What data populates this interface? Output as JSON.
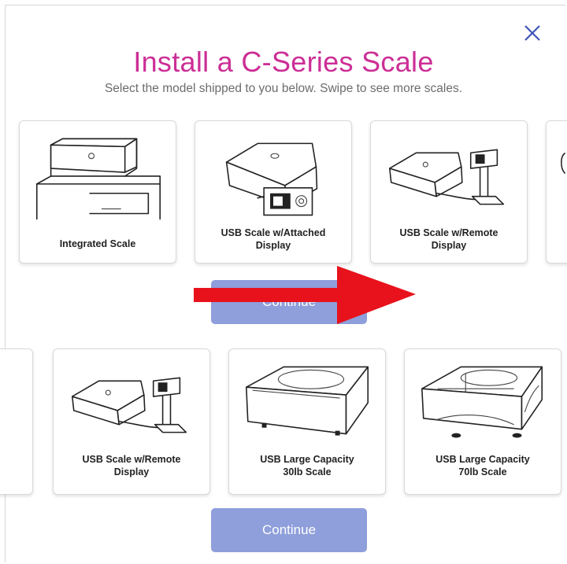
{
  "dialog": {
    "title": "Install a C-Series Scale",
    "subtitle": "Select the model shipped to you below. Swipe to see more scales.",
    "close_icon": "close-icon"
  },
  "top_row": {
    "cards": [
      {
        "label_line1": "Integrated Scale",
        "label_line2": ""
      },
      {
        "label_line1": "USB Scale w/Attached",
        "label_line2": "Display"
      },
      {
        "label_line1": "USB Scale w/Remote",
        "label_line2": "Display"
      }
    ],
    "continue_label": "Continue"
  },
  "bottom_row": {
    "cards": [
      {
        "label_line1": "USB Scale w/Remote",
        "label_line2": "Display"
      },
      {
        "label_line1": "USB Large Capacity",
        "label_line2": "30lb Scale"
      },
      {
        "label_line1": "USB Large Capacity",
        "label_line2": "70lb Scale"
      }
    ],
    "continue_label": "Continue"
  },
  "annotation": {
    "arrow": "red-swipe-arrow-icon",
    "color": "#e8121c"
  },
  "colors": {
    "title": "#cc2e96",
    "button": "#8f9fdb",
    "close": "#3f55b8"
  }
}
